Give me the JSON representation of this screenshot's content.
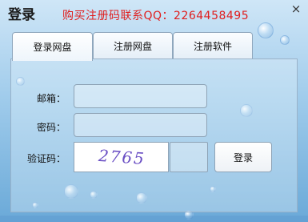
{
  "window": {
    "title": "登录",
    "promo_text": "购买注册码联系QQ：2264458495",
    "close_label": "×"
  },
  "tabs": [
    {
      "label": "登录网盘",
      "active": true
    },
    {
      "label": "注册网盘",
      "active": false
    },
    {
      "label": "注册软件",
      "active": false
    }
  ],
  "form": {
    "email_label": "邮箱：",
    "email_value": "",
    "password_label": "密码：",
    "password_value": "",
    "captcha_label": "验证码：",
    "captcha_image_text": "2765",
    "captcha_value": "",
    "login_button": "登录"
  },
  "colors": {
    "promo": "#e01e1e",
    "background_top": "#cfe6f7",
    "background_bottom": "#6aa9d8"
  }
}
